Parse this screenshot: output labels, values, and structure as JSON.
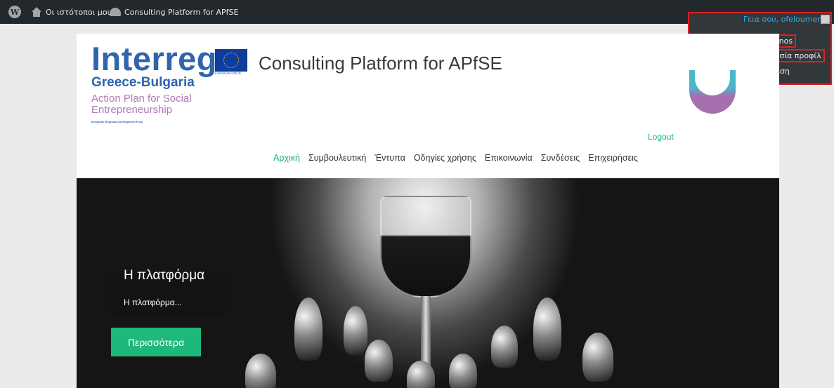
{
  "adminbar": {
    "wp_icon": "wordpress-logo-icon",
    "my_sites": "Οι ιστότοποι μου",
    "site_name": "Consulting Platform for APfSE",
    "howdy": "Γεια σου, ofeloumenos"
  },
  "user_menu": {
    "username": "ofeloumenos",
    "edit_profile": "Επεξεργασία προφίλ",
    "logout": "Αποσύνδεση",
    "highlight_color": "#d9221f"
  },
  "header": {
    "logo_interreg": "Interreg",
    "logo_region": "Greece-Bulgaria",
    "logo_subtitle": "Action Plan for Social Entrepreneurship",
    "logo_fund": "European Regional Development Fund",
    "eu_label": "EUROPEAN UNION",
    "title": "Consulting Platform for APfSE",
    "logout_link": "Logout"
  },
  "nav": {
    "items": [
      "Αρχική",
      "Συμβουλευτική",
      "Έντυπα",
      "Οδηγίες χρήσης",
      "Επικοινωνία",
      "Συνδέσεις",
      "Επιχειρήσεις"
    ],
    "active_color": "#1aaf74"
  },
  "hero": {
    "title": "Η πλατφόρμα",
    "subtitle": "Η πλατφόρμα...",
    "button": "Περισσότερα",
    "button_color": "#1fb87b"
  }
}
